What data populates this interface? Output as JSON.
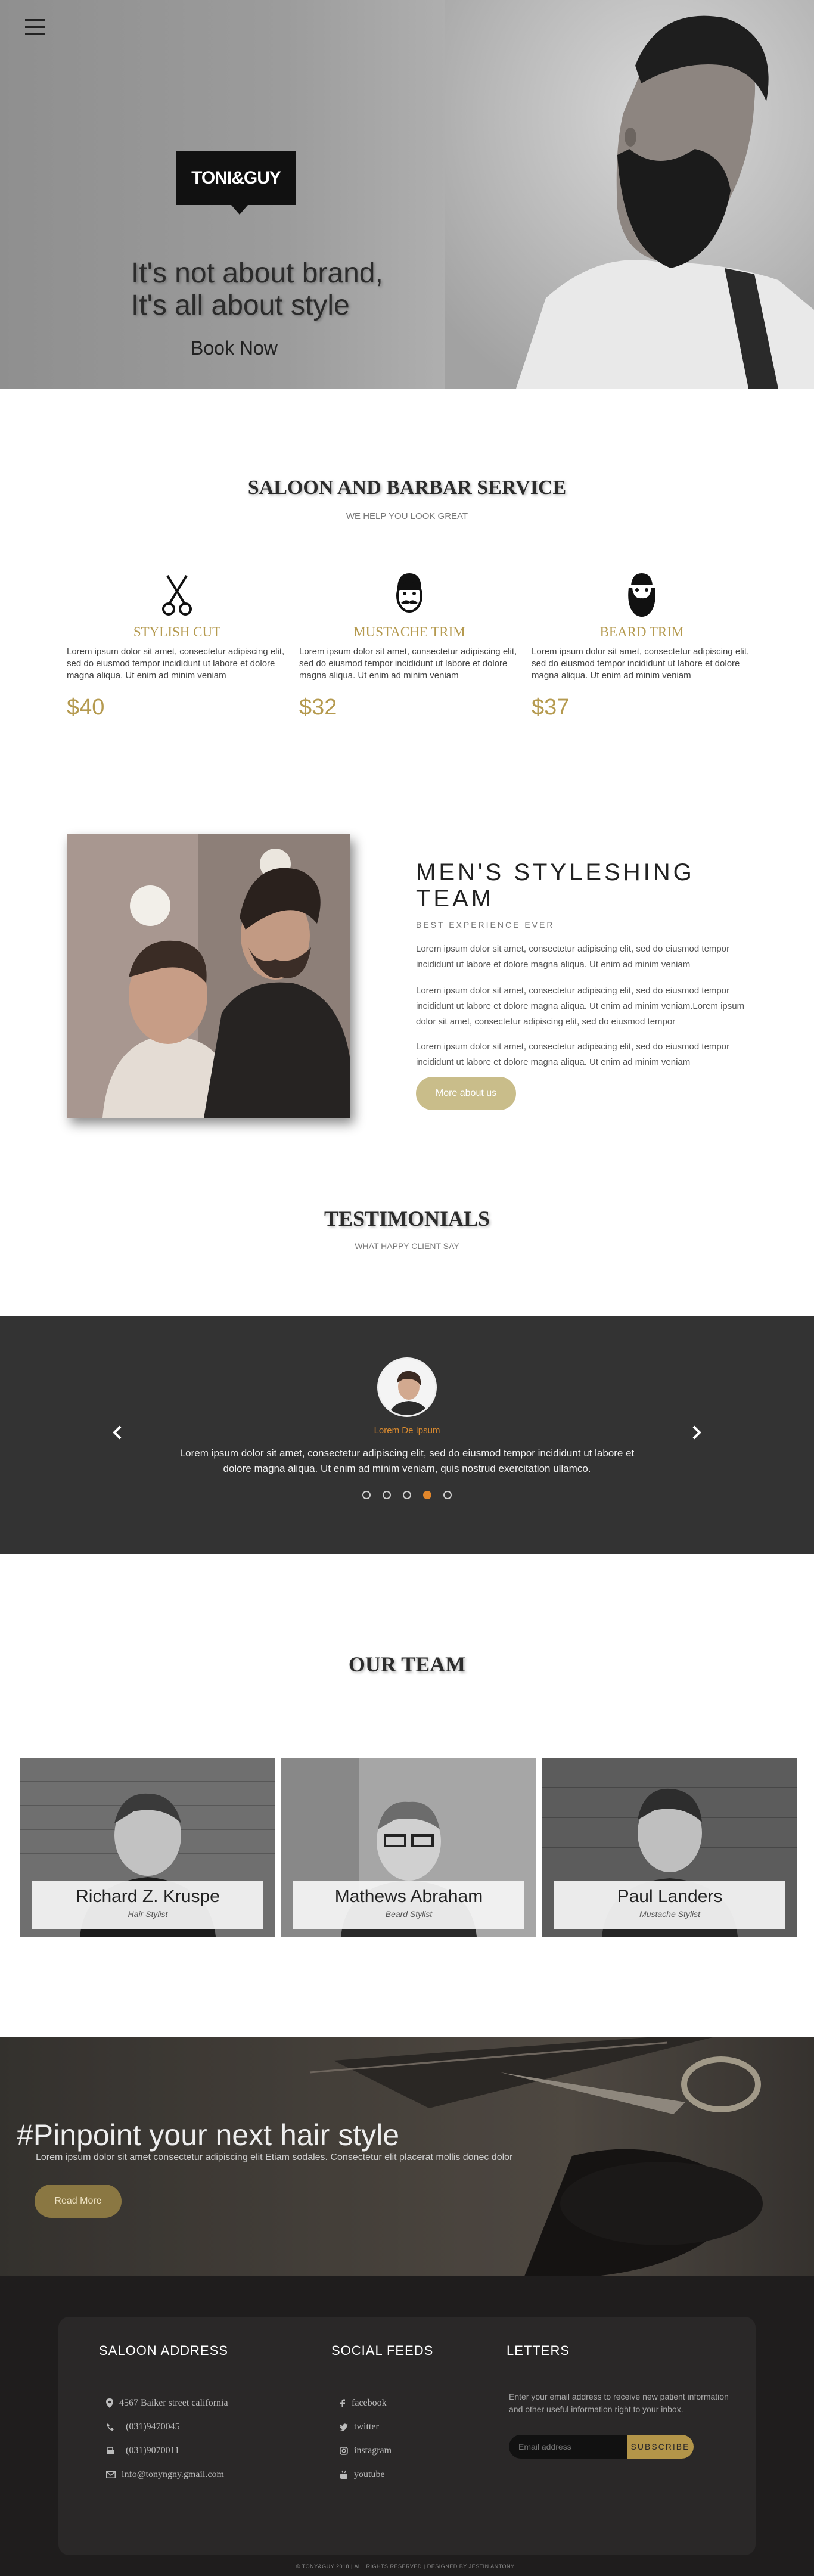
{
  "hero": {
    "logo": "TONI&GUY",
    "tagline_line1": "It's not about brand,",
    "tagline_line2": "It's all about style",
    "book_label": "Book Now",
    "icon": "hamburger-menu-icon"
  },
  "services": {
    "title": "SALOON AND BARBAR SERVICE",
    "subtitle": "WE HELP YOU LOOK GREAT",
    "items": [
      {
        "icon": "scissors-icon",
        "name": "STYLISH CUT",
        "text": "Lorem ipsum dolor sit amet, consectetur adipiscing elit, sed do eiusmod tempor incididunt ut labore et dolore magna aliqua. Ut enim ad minim veniam",
        "price": "$40"
      },
      {
        "icon": "mustache-face-icon",
        "name": "MUSTACHE TRIM",
        "text": "Lorem ipsum dolor sit amet, consectetur adipiscing elit, sed do eiusmod tempor incididunt ut labore et dolore magna aliqua. Ut enim ad minim veniam",
        "price": "$32"
      },
      {
        "icon": "beard-face-icon",
        "name": "BEARD TRIM",
        "text": "Lorem ipsum dolor sit amet, consectetur adipiscing elit, sed do eiusmod tempor incididunt ut labore et dolore magna aliqua. Ut enim ad minim veniam",
        "price": "$37"
      }
    ]
  },
  "about": {
    "title_line1": "MEN'S STYLESHING",
    "title_line2": "TEAM",
    "subtitle": "BEST EXPERIENCE EVER",
    "p1": "Lorem ipsum dolor sit amet, consectetur adipiscing elit, sed do eiusmod tempor incididunt ut labore et dolore magna aliqua. Ut enim ad minim veniam",
    "p2": "Lorem ipsum dolor sit amet, consectetur adipiscing elit, sed do eiusmod tempor incididunt ut labore et dolore magna aliqua. Ut enim ad minim veniam.Lorem ipsum dolor sit amet, consectetur adipiscing elit, sed do eiusmod tempor",
    "p3": "Lorem ipsum dolor sit amet, consectetur adipiscing elit, sed do eiusmod tempor incididunt ut labore et dolore magna aliqua. Ut enim ad minim veniam",
    "button": "More about us"
  },
  "testimonials": {
    "title": "TESTIMONIALS",
    "subtitle": "WHAT HAPPY CLIENT SAY",
    "name": "Lorem De Ipsum",
    "quote": "Lorem ipsum dolor sit amet, consectetur adipiscing elit, sed do eiusmod tempor incididunt ut labore et dolore magna aliqua. Ut enim ad minim veniam, quis nostrud exercitation ullamco.",
    "active_slide": 4,
    "slide_count": 5
  },
  "team": {
    "title": "OUR TEAM",
    "members": [
      {
        "name": "Richard Z. Kruspe",
        "role": "Hair Stylist"
      },
      {
        "name": "Mathews Abraham",
        "role": "Beard Stylist"
      },
      {
        "name": "Paul Landers",
        "role": "Mustache Stylist"
      }
    ]
  },
  "banner": {
    "title": "#Pinpoint your next hair style",
    "text": "Lorem ipsum dolor sit amet consectetur adipiscing elit Etiam sodales. Consectetur elit placerat mollis donec dolor",
    "button": "Read More"
  },
  "footer": {
    "address_title": "SALOON ADDRESS",
    "address": "4567 Baiker street california",
    "phone": "+(031)9470045",
    "fax": "+(031)9070011",
    "email": "info@tonyngny.gmail.com",
    "social_title": "SOCIAL FEEDS",
    "social": [
      "facebook",
      "twitter",
      "instagram",
      "youtube"
    ],
    "letters_title": "LETTERS",
    "letters_text": "Enter your email address to receive new patient information and other useful information right to your inbox.",
    "email_placeholder": "Email address",
    "subscribe": "SUBSCRIBE",
    "copyright": "© TONY&GUY 2018 | ALL RIGHTS RESERVED | DESIGNED BY JESTIN ANTONY |"
  },
  "colors": {
    "accent_gold": "#b59a4f",
    "dark": "#333333",
    "active_dot": "#e1862b"
  }
}
